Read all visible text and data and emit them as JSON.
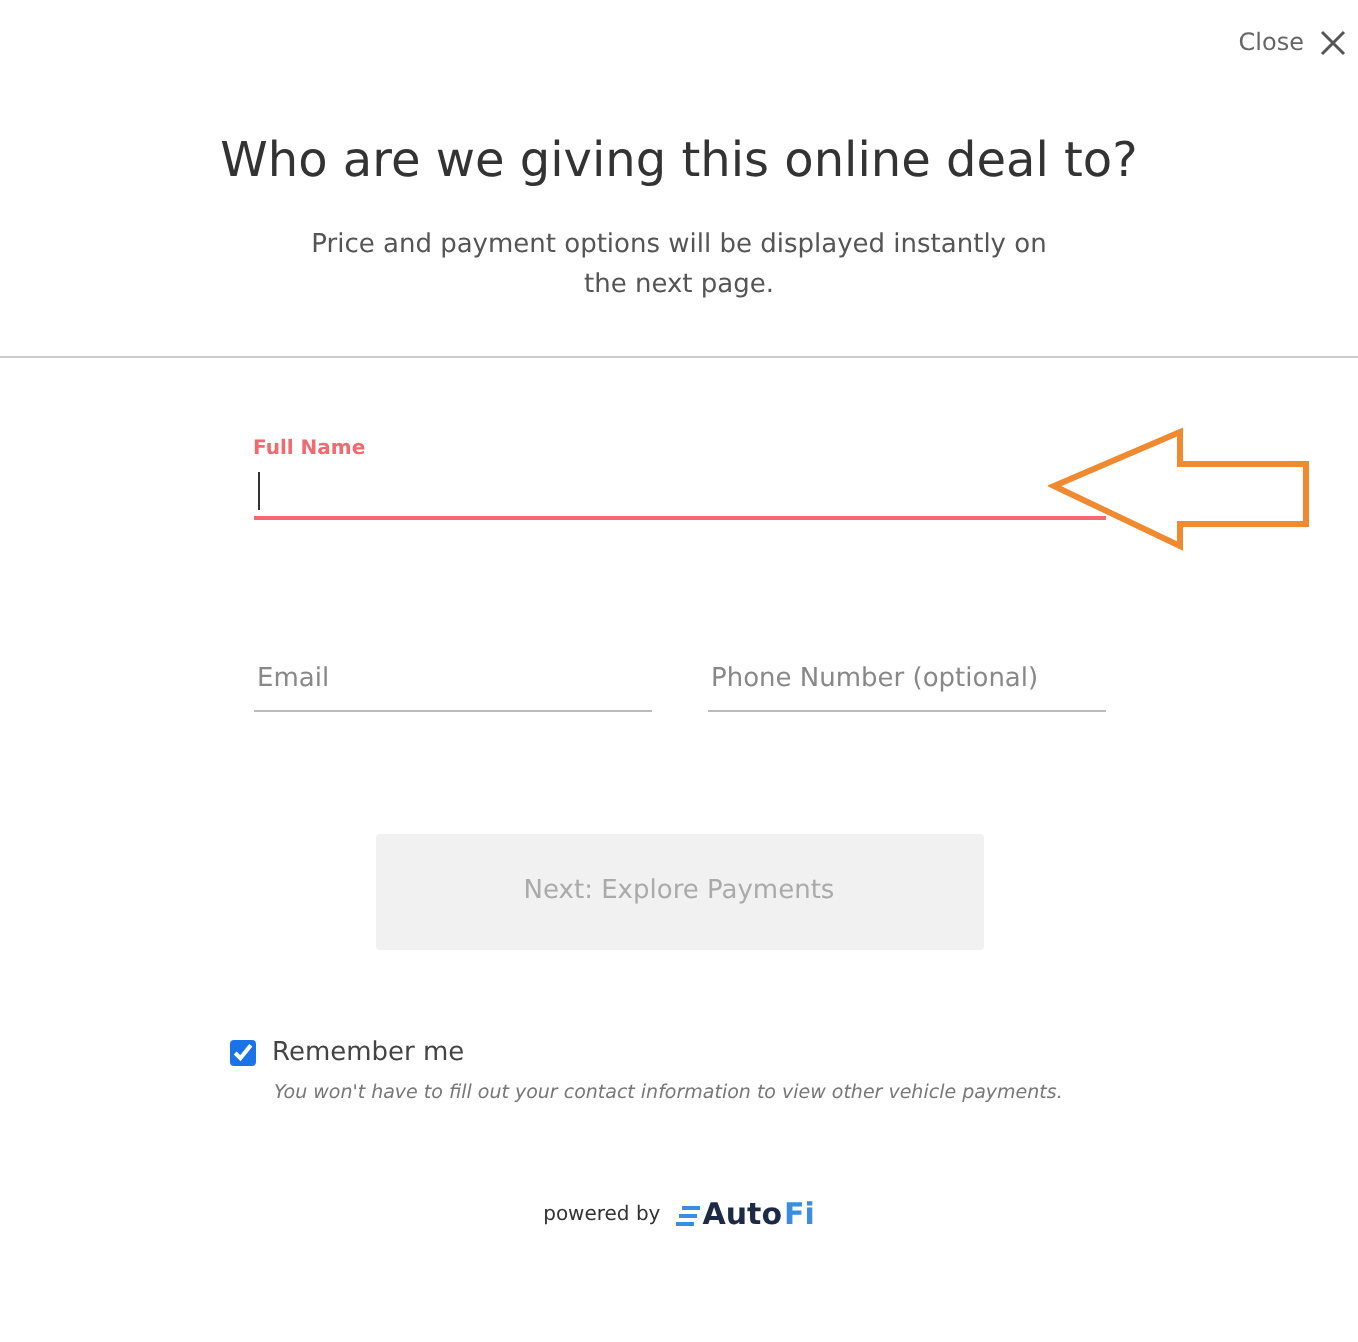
{
  "close": {
    "label": "Close"
  },
  "title": "Who are we giving this online deal to?",
  "subtitle": "Price and payment options will be displayed instantly on the next page.",
  "fields": [
    {
      "label": "Full Name",
      "focused": true
    },
    {
      "placeholder": "Email",
      "focused": false
    },
    {
      "placeholder": "Phone Number (optional)",
      "focused": false
    }
  ],
  "submit": {
    "label": "Next: Explore Payments",
    "disabled": true
  },
  "remember": {
    "label": "Remember me",
    "checked": true,
    "hint": "You won't have to fill out your contact information to view other vehicle payments."
  },
  "footer": {
    "powered_by": "powered by",
    "logo": {
      "main": "Auto",
      "accent": "Fi"
    }
  },
  "annotation": {
    "kind": "arrow"
  }
}
